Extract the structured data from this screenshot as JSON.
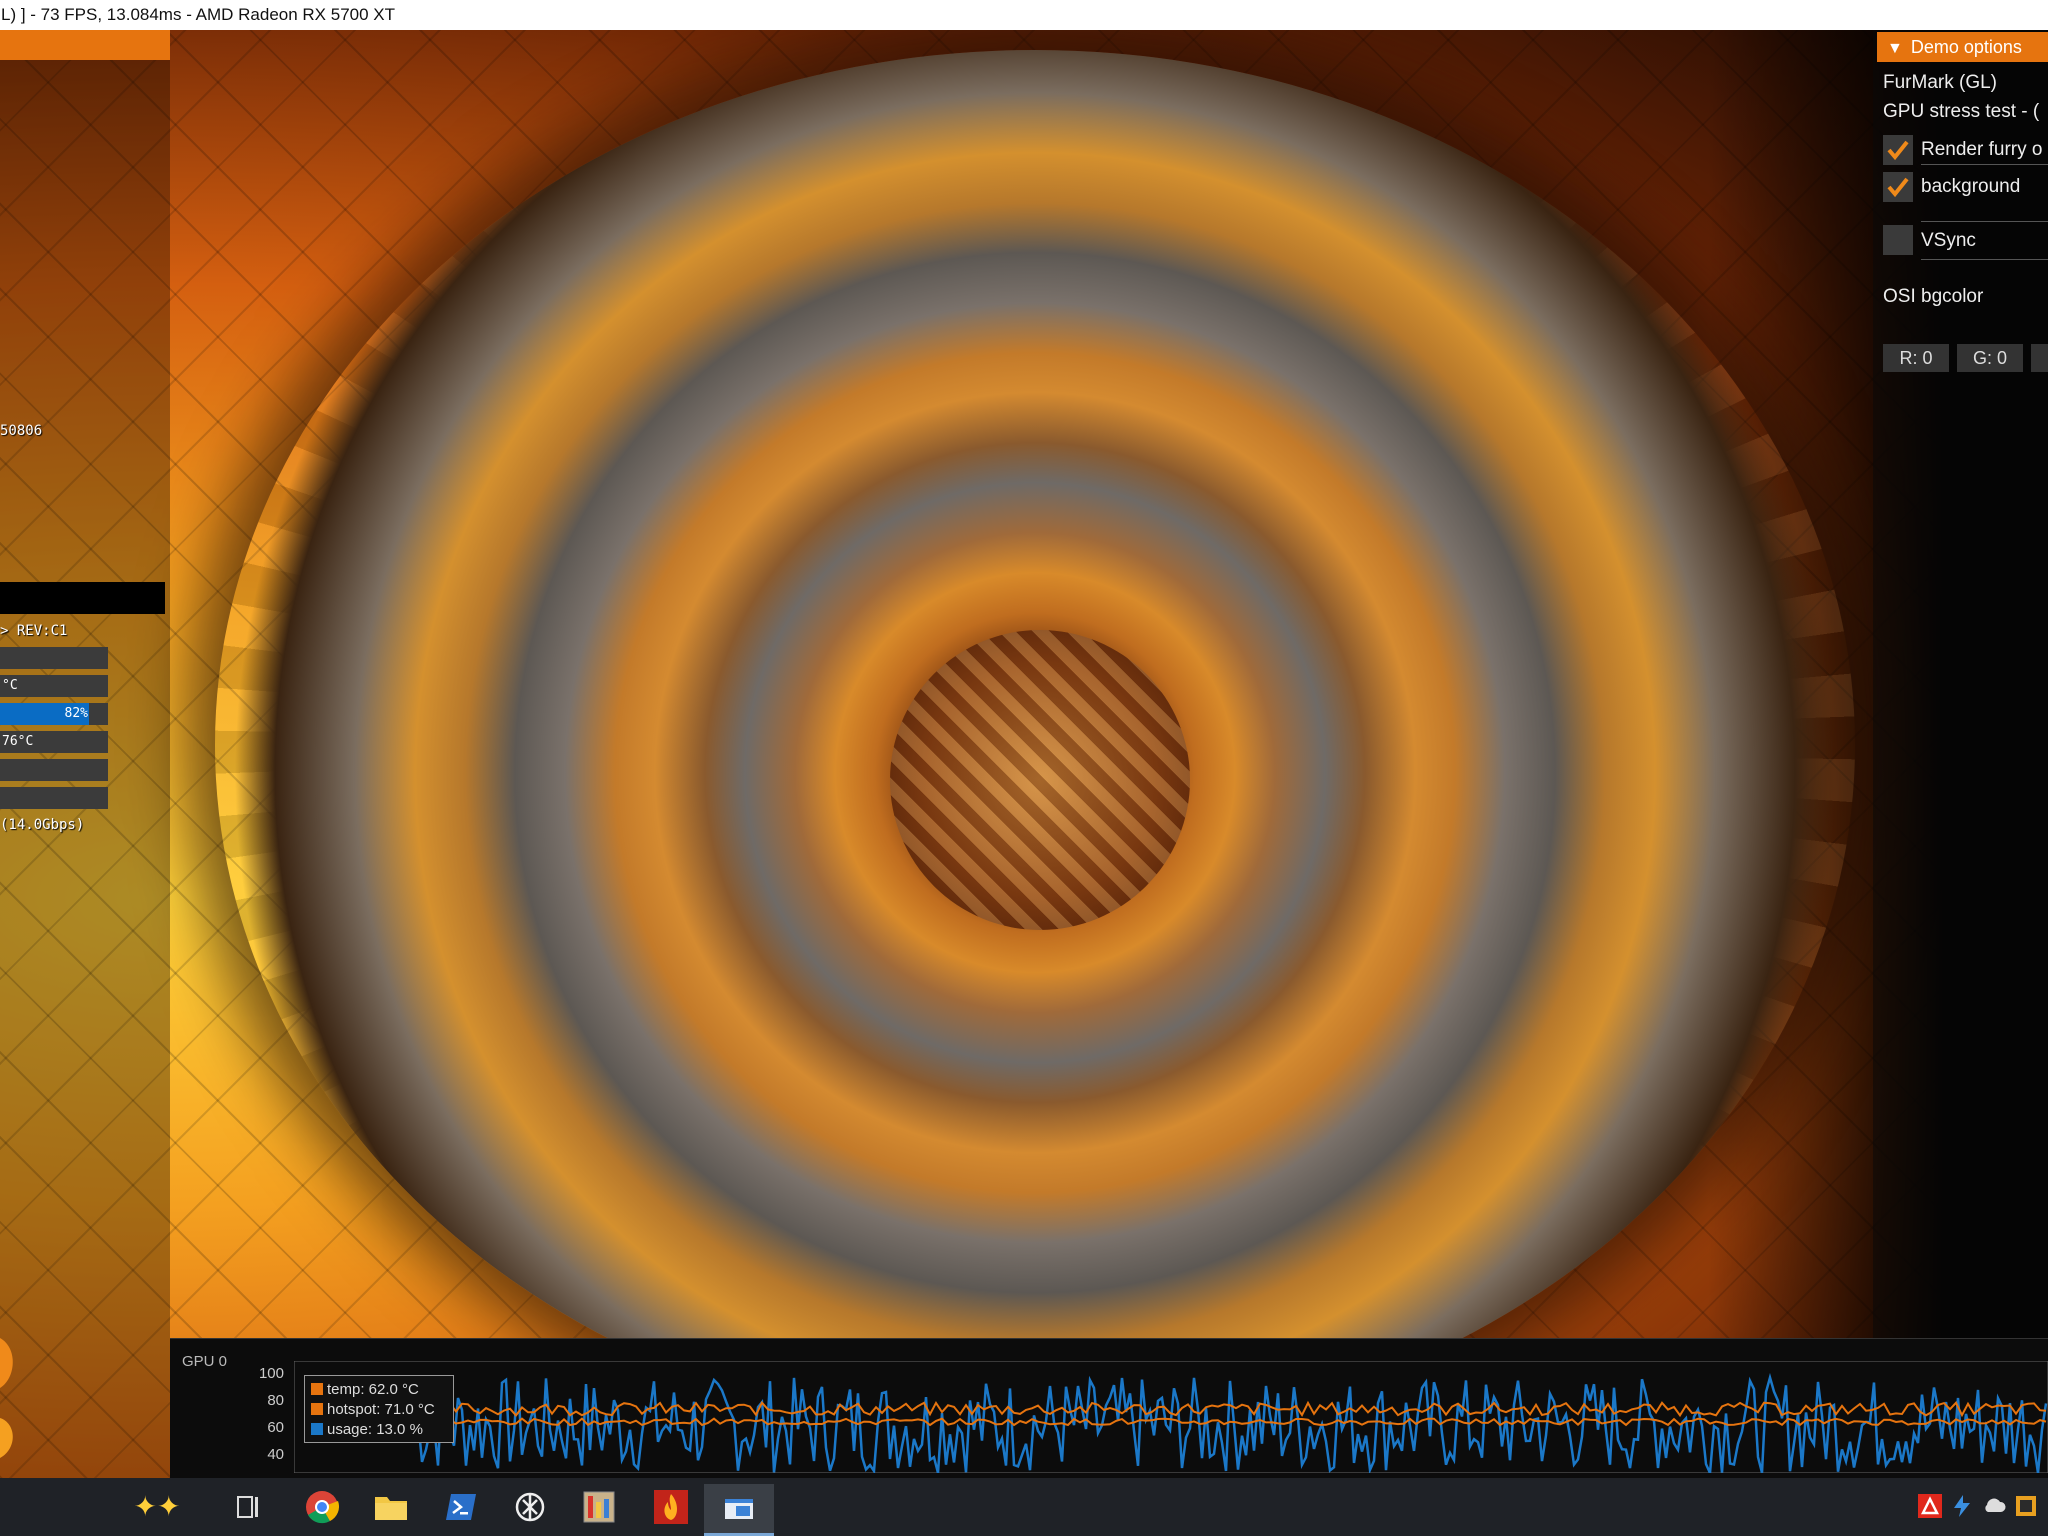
{
  "window": {
    "title": "L) ] - 73 FPS, 13.084ms - AMD Radeon RX 5700 XT"
  },
  "osd": {
    "line_id": "50806",
    "rev_line": "> REV:C1",
    "bar1_label": "",
    "bar2_label": "°C",
    "usage_bar": {
      "label": "82%",
      "value": 82
    },
    "hotspot_label": "76°C",
    "mem_line": "(14.0Gbps)"
  },
  "demo_options": {
    "header": "Demo options",
    "app_name": "FurMark (GL)",
    "mode": "GPU stress test - (",
    "checkboxes": [
      {
        "label": "Render furry o",
        "checked": true
      },
      {
        "label": "background",
        "checked": true
      },
      {
        "label": "VSync",
        "checked": false
      }
    ],
    "bgcolor_label": "OSI bgcolor",
    "rgb": {
      "r": "R: 0",
      "g": "G: 0"
    }
  },
  "graph": {
    "gpu_label": "GPU 0",
    "yticks": [
      "100",
      "80",
      "60",
      "40"
    ],
    "legend": [
      {
        "label": "temp: 62.0 °C",
        "color": "#e6740f"
      },
      {
        "label": "hotspot: 71.0 °C",
        "color": "#e6740f"
      },
      {
        "label": "usage: 13.0 %",
        "color": "#1b78c8"
      }
    ],
    "colors": {
      "temp": "#e6740f",
      "usage": "#1b78c8"
    }
  },
  "taskbar": {
    "icons": [
      "copilot-icon",
      "task-view-icon",
      "chrome-icon",
      "file-explorer-icon",
      "powershell-icon",
      "chatgpt-icon",
      "gpu-monitor-icon",
      "furmark-icon",
      "active-app-icon"
    ],
    "tray": [
      "amd-icon",
      "flash-icon",
      "cloud-icon",
      "app-icon"
    ]
  }
}
